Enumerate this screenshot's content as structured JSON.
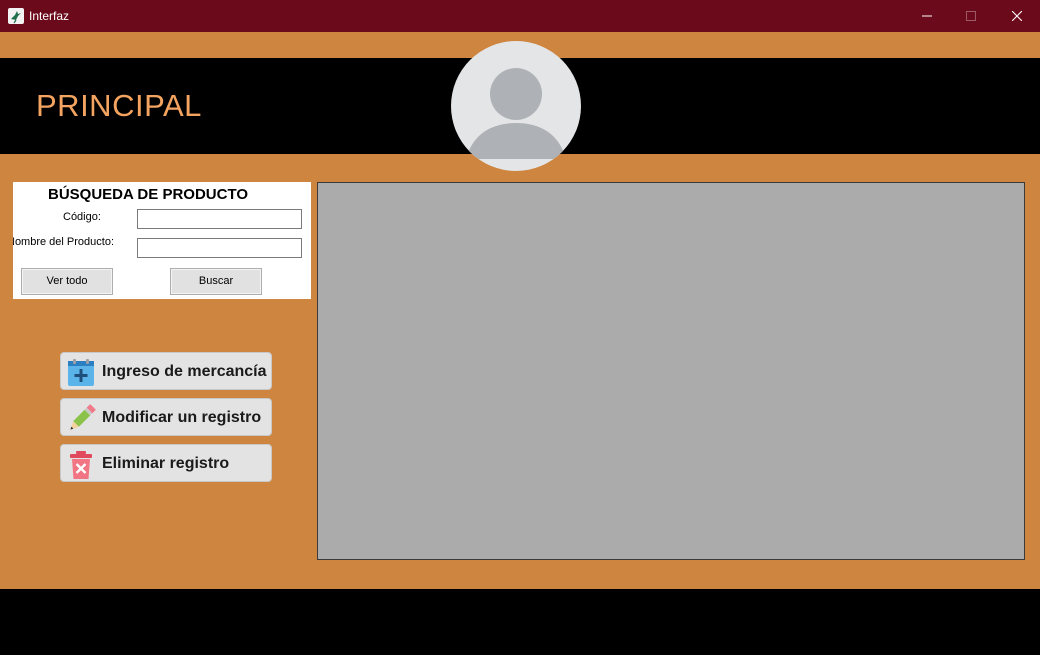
{
  "window": {
    "title": "Interfaz",
    "icon": "hummingbird-app-icon",
    "controls": [
      "minimize-icon",
      "maximize-icon",
      "close-icon"
    ]
  },
  "header": {
    "title": "PRINCIPAL",
    "avatar": "user-silhouette-icon"
  },
  "search": {
    "title": "BÚSQUEDA DE PRODUCTO",
    "code_label": "Código:",
    "code_value": "",
    "name_label": "Nombre del Producto:",
    "name_value": "",
    "view_all_label": "Ver todo",
    "search_label": "Buscar"
  },
  "actions": [
    {
      "label": "Ingreso de mercancía",
      "icon": "calendar-add-icon"
    },
    {
      "label": "Modificar un registro",
      "icon": "pencil-icon"
    },
    {
      "label": "Eliminar registro",
      "icon": "trash-delete-icon"
    }
  ],
  "colors": {
    "title_bar": "#6b0a1b",
    "background": "#cd853f",
    "header_band": "#000000",
    "title_text": "#f4a460",
    "grid": "#ababab"
  }
}
